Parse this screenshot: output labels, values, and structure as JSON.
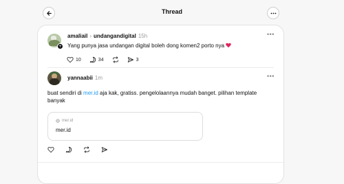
{
  "header": {
    "title": "Thread"
  },
  "post": {
    "author": "amaliail",
    "reply_to": "undangandigital",
    "time": "15h",
    "text": "Yang punya jasa undangan digital boleh dong komen2 porto nya",
    "likes": "10",
    "replies": "34",
    "shares": "3"
  },
  "reply": {
    "author": "yannaabii",
    "time": "1m",
    "text_before_link": "buat sendiri di ",
    "link_text": "mer.id",
    "text_after_link": " aja kak, gratiss. pengelolaannya mudah banget. pilihan template banyak",
    "link_card": {
      "domain": "mer.id",
      "title": "mer.id"
    }
  },
  "colors": {
    "link": "#1d9bf0",
    "heart": "#e0245e",
    "muted": "#999999"
  },
  "icons": [
    "back-arrow-icon",
    "more-icon",
    "heart-icon",
    "comment-icon",
    "repost-icon",
    "share-icon",
    "globe-icon",
    "plus-icon"
  ]
}
